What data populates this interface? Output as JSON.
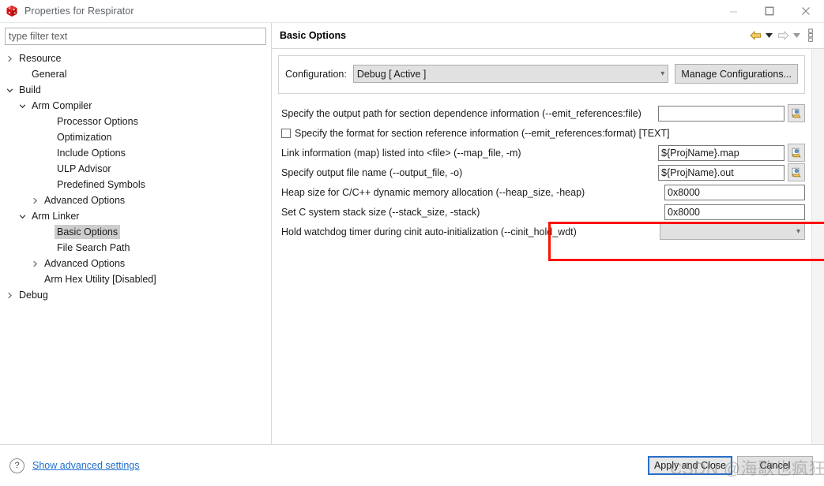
{
  "window": {
    "title": "Properties for Respirator",
    "app_icon": "red-cube-icon",
    "controls": {
      "minimize": "minimize-icon",
      "maximize": "maximize-icon",
      "close": "close-icon"
    }
  },
  "sidebar": {
    "filter": {
      "value": "",
      "placeholder": "type filter text"
    },
    "items": [
      {
        "label": "Resource",
        "indent": 0,
        "twisty": "collapsed",
        "selected": false
      },
      {
        "label": "General",
        "indent": 1,
        "twisty": "none",
        "selected": false
      },
      {
        "label": "Build",
        "indent": 0,
        "twisty": "expanded",
        "selected": false
      },
      {
        "label": "Arm Compiler",
        "indent": 1,
        "twisty": "expanded",
        "selected": false
      },
      {
        "label": "Processor Options",
        "indent": 3,
        "twisty": "none",
        "selected": false
      },
      {
        "label": "Optimization",
        "indent": 3,
        "twisty": "none",
        "selected": false
      },
      {
        "label": "Include Options",
        "indent": 3,
        "twisty": "none",
        "selected": false
      },
      {
        "label": "ULP Advisor",
        "indent": 3,
        "twisty": "none",
        "selected": false
      },
      {
        "label": "Predefined Symbols",
        "indent": 3,
        "twisty": "none",
        "selected": false
      },
      {
        "label": "Advanced Options",
        "indent": 2,
        "twisty": "collapsed",
        "selected": false
      },
      {
        "label": "Arm Linker",
        "indent": 1,
        "twisty": "expanded",
        "selected": false
      },
      {
        "label": "Basic Options",
        "indent": 3,
        "twisty": "none",
        "selected": true
      },
      {
        "label": "File Search Path",
        "indent": 3,
        "twisty": "none",
        "selected": false
      },
      {
        "label": "Advanced Options",
        "indent": 2,
        "twisty": "collapsed",
        "selected": false
      },
      {
        "label": "Arm Hex Utility  [Disabled]",
        "indent": 2,
        "twisty": "none",
        "selected": false
      },
      {
        "label": "Debug",
        "indent": 0,
        "twisty": "collapsed",
        "selected": false
      }
    ]
  },
  "page": {
    "title": "Basic Options",
    "toolbar": [
      {
        "name": "back-arrow-icon",
        "kind": "arrow-left-active"
      },
      {
        "name": "back-dropdown-icon",
        "kind": "caret-active"
      },
      {
        "name": "forward-arrow-icon",
        "kind": "arrow-right-disabled"
      },
      {
        "name": "forward-dropdown-icon",
        "kind": "caret-disabled"
      },
      {
        "name": "view-menu-icon",
        "kind": "vertical-dots"
      }
    ],
    "configuration": {
      "label": "Configuration:",
      "value": "Debug  [ Active ]",
      "manage_button": "Manage Configurations..."
    },
    "options": [
      {
        "kind": "text",
        "label": "Specify the output path for section dependence information (--emit_references:file)",
        "value": "",
        "browse": true
      },
      {
        "kind": "checkbox",
        "label": "Specify the format for section reference information (--emit_references:format) [TEXT]",
        "checked": false
      },
      {
        "kind": "text",
        "label": "Link information (map) listed into <file> (--map_file, -m)",
        "value": "${ProjName}.map",
        "browse": true
      },
      {
        "kind": "text",
        "label": "Specify output file name (--output_file, -o)",
        "value": "${ProjName}.out",
        "browse": true
      },
      {
        "kind": "text",
        "label": "Heap size for C/C++ dynamic memory allocation (--heap_size, -heap)",
        "value": "0x8000",
        "browse": false,
        "highlighted": true
      },
      {
        "kind": "text",
        "label": "Set C system stack size (--stack_size, -stack)",
        "value": "0x8000",
        "browse": false,
        "highlighted": true
      },
      {
        "kind": "dropdown",
        "label": "Hold watchdog timer during cinit auto-initialization (--cinit_hold_wdt)",
        "value": ""
      }
    ],
    "annotation": {
      "color": "#fb1200",
      "targets": [
        "heap-size-row",
        "stack-size-row"
      ]
    }
  },
  "footer": {
    "help_icon": "question-mark-icon",
    "advanced_link": "Show advanced settings",
    "apply_button": "Apply and Close",
    "cancel_button": "Cancel"
  },
  "watermark": {
    "text": "CSDN @海歌也疯狂"
  }
}
